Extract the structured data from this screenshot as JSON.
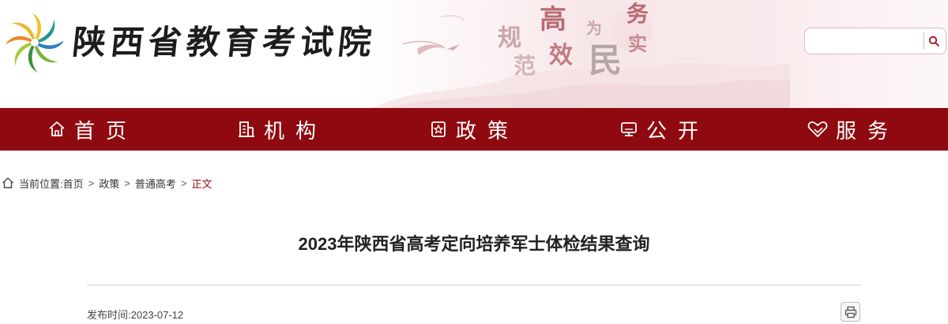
{
  "header": {
    "site_name": "陕西省教育考试院",
    "slogan": [
      "规",
      "高",
      "为",
      "务",
      "范",
      "效",
      "民",
      "实"
    ]
  },
  "search": {
    "value": "",
    "placeholder": ""
  },
  "nav": {
    "items": [
      {
        "label": "首页",
        "icon": "home-icon"
      },
      {
        "label": "机构",
        "icon": "building-icon"
      },
      {
        "label": "政策",
        "icon": "policy-icon"
      },
      {
        "label": "公开",
        "icon": "monitor-icon"
      },
      {
        "label": "服务",
        "icon": "handshake-icon"
      }
    ]
  },
  "breadcrumb": {
    "label": "当前位置:",
    "separator": ">",
    "items": [
      "首页",
      "政策",
      "普通高考"
    ],
    "current": "正文"
  },
  "article": {
    "title": "2023年陕西省高考定向培养军士体检结果查询",
    "date_label": "发布时间:",
    "date": "2023-07-12"
  },
  "colors": {
    "nav_bg": "#8f0a10",
    "accent": "#9a0f16"
  }
}
